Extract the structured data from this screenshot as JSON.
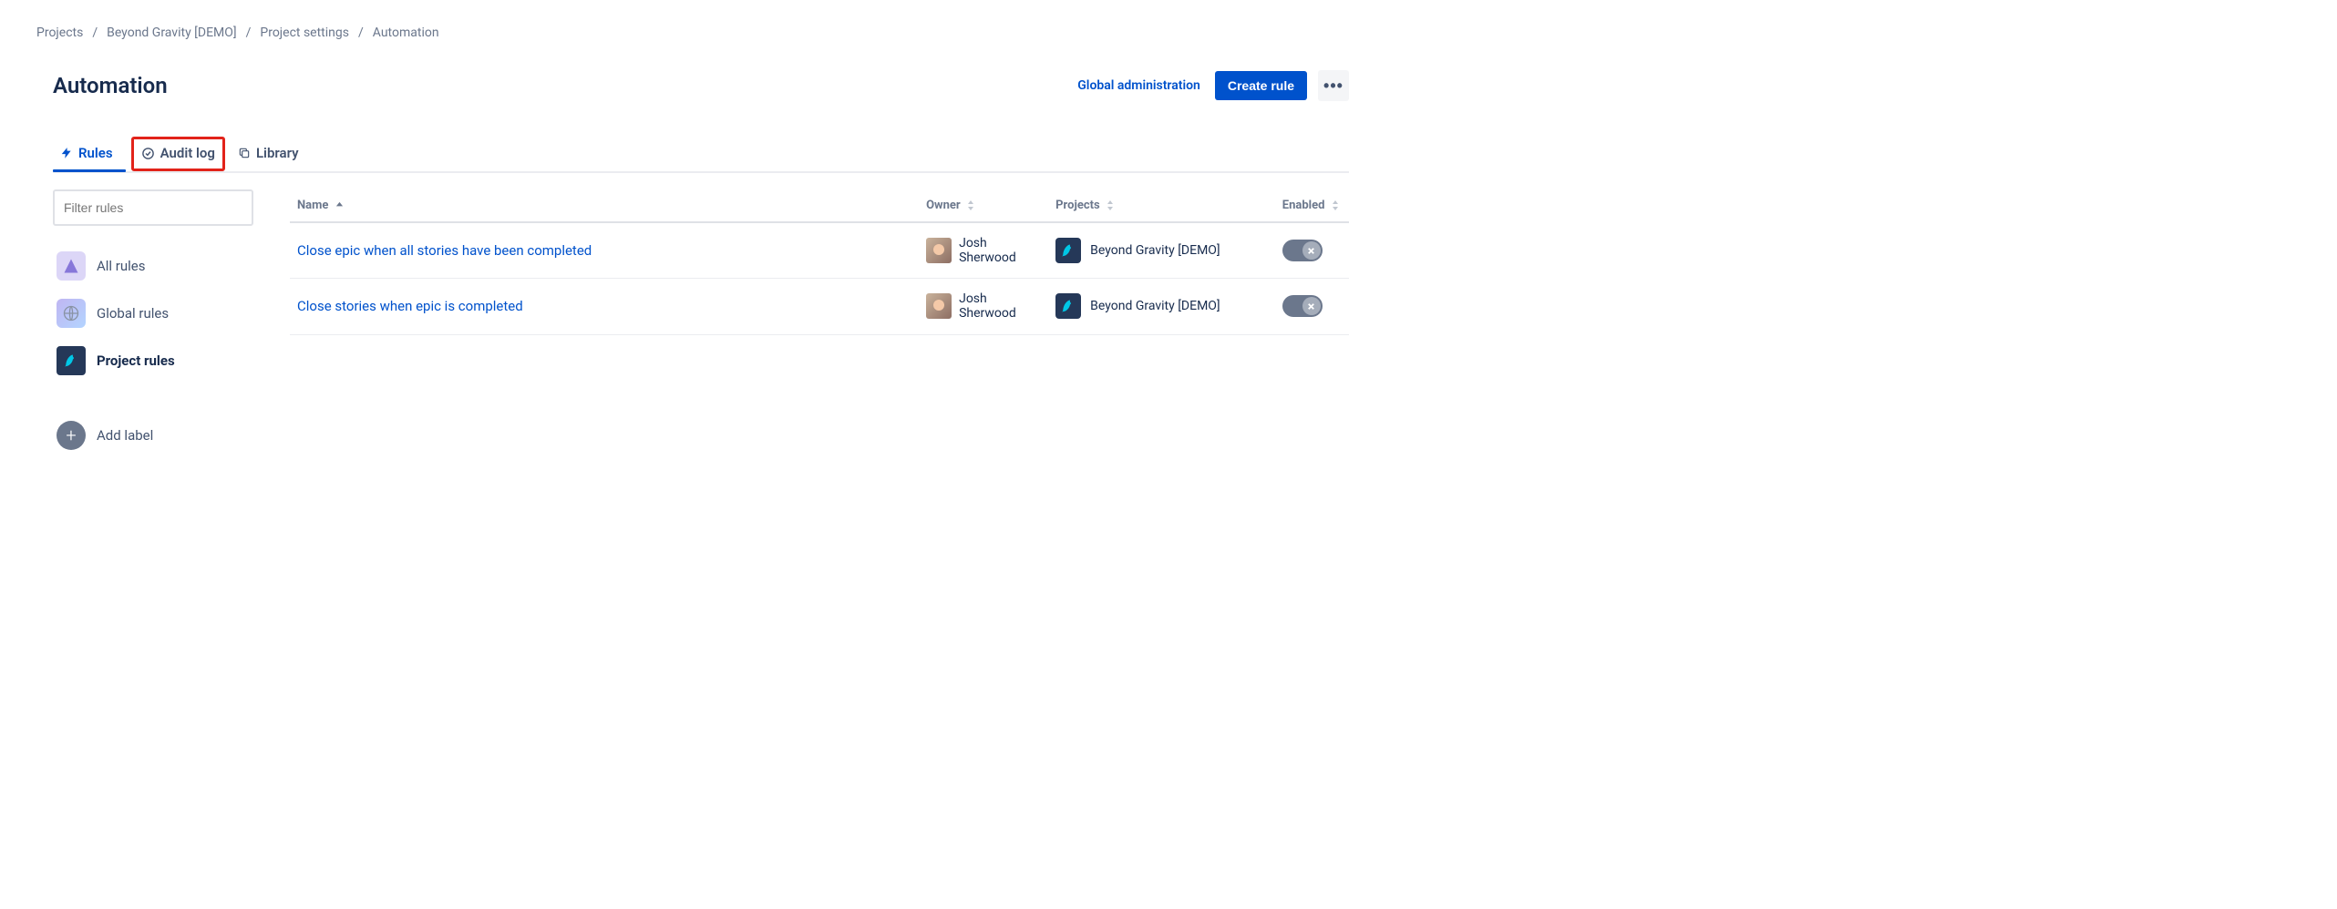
{
  "breadcrumb": {
    "items": [
      "Projects",
      "Beyond Gravity [DEMO]",
      "Project settings",
      "Automation"
    ]
  },
  "header": {
    "title": "Automation",
    "globalAdminLabel": "Global administration",
    "createRuleLabel": "Create rule"
  },
  "tabs": {
    "rules": "Rules",
    "auditLog": "Audit log",
    "library": "Library",
    "active": "Rules",
    "highlighted": "Audit log"
  },
  "sidebar": {
    "filterPlaceholder": "Filter rules",
    "items": [
      {
        "label": "All rules",
        "icon": "all-rules-icon",
        "active": false
      },
      {
        "label": "Global rules",
        "icon": "globe-icon",
        "active": false
      },
      {
        "label": "Project rules",
        "icon": "rocket-icon",
        "active": true
      }
    ],
    "addLabel": "Add label"
  },
  "table": {
    "columns": {
      "name": "Name",
      "owner": "Owner",
      "projects": "Projects",
      "enabled": "Enabled"
    },
    "sortColumn": "name",
    "sortDir": "asc",
    "rows": [
      {
        "name": "Close epic when all stories have been completed",
        "owner": "Josh Sherwood",
        "project": "Beyond Gravity [DEMO]",
        "enabled": false
      },
      {
        "name": "Close stories when epic is completed",
        "owner": "Josh Sherwood",
        "project": "Beyond Gravity [DEMO]",
        "enabled": false
      }
    ]
  }
}
